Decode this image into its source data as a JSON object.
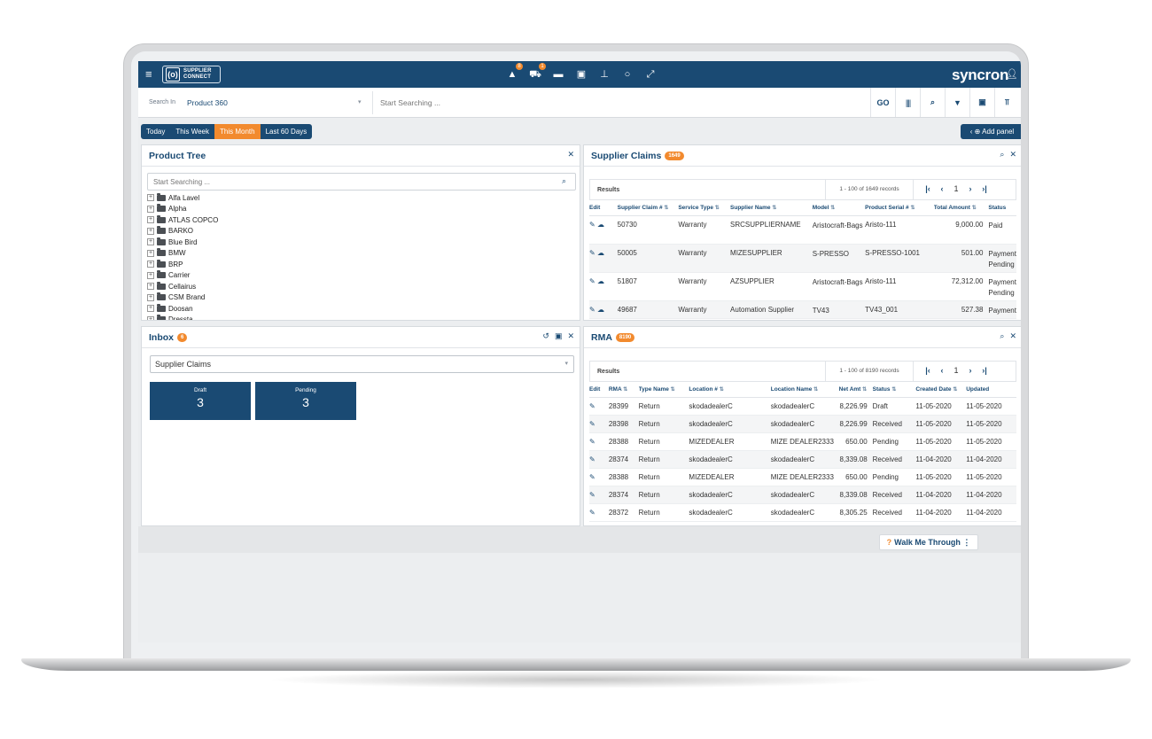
{
  "topbar": {
    "logo_mark": "(o)",
    "logo_line1": "SUPPLIER",
    "logo_line2": "CONNECT",
    "brand": "syncron",
    "icons": [
      {
        "name": "bell-icon",
        "glyph": "▲",
        "badge": "8"
      },
      {
        "name": "cart-icon",
        "glyph": "⛟",
        "badge": "1"
      },
      {
        "name": "monitor-icon",
        "glyph": "▬",
        "badge": ""
      },
      {
        "name": "box-icon",
        "glyph": "▣",
        "badge": ""
      },
      {
        "name": "download-icon",
        "glyph": "⊥",
        "badge": ""
      },
      {
        "name": "clock-icon",
        "glyph": "○",
        "badge": ""
      },
      {
        "name": "expand-icon",
        "glyph": "⤢",
        "badge": ""
      }
    ]
  },
  "search": {
    "in_label": "Search In",
    "in_value": "Product 360",
    "placeholder": "Start Searching ...",
    "go_label": "GO"
  },
  "date_range": {
    "options": [
      "Today",
      "This Week",
      "This Month",
      "Last 60 Days"
    ],
    "active": "This Month"
  },
  "add_panel_label": "Add panel",
  "product_tree": {
    "title": "Product Tree",
    "search_placeholder": "Start Searching ...",
    "items": [
      "Alfa Lavel",
      "Alpha",
      "ATLAS COPCO",
      "BARKO",
      "Blue Bird",
      "BMW",
      "BRP",
      "Carrier",
      "Cellairus",
      "CSM Brand",
      "Doosan",
      "Dressta"
    ]
  },
  "supplier_claims": {
    "title": "Supplier Claims",
    "count": "1649",
    "results_label": "Results",
    "records": "1 - 100 of 1649 records",
    "page": "1",
    "columns": [
      "Edit",
      "Supplier Claim #",
      "Service Type",
      "Supplier Name",
      "Model",
      "Product Serial #",
      "Total Amount",
      "Status"
    ],
    "rows": [
      {
        "claim": "50730",
        "service": "Warranty",
        "supplier": "SRCSUPPLIERNAME",
        "model": "Aristocraft-Bags",
        "serial": "Aristo-111",
        "amount": "9,000.00",
        "status": "Paid"
      },
      {
        "claim": "50005",
        "service": "Warranty",
        "supplier": "MIZESUPPLIER",
        "model": "S-PRESSO",
        "serial": "S-PRESSO-1001",
        "amount": "501.00",
        "status": "Payment Pending"
      },
      {
        "claim": "51807",
        "service": "Warranty",
        "supplier": "AZSUPPLIER",
        "model": "Aristocraft-Bags",
        "serial": "Aristo-111",
        "amount": "72,312.00",
        "status": "Payment Pending"
      },
      {
        "claim": "49687",
        "service": "Warranty",
        "supplier": "Automation Supplier",
        "model": "TV43",
        "serial": "TV43_001",
        "amount": "527.38",
        "status": "Payment"
      }
    ]
  },
  "inbox": {
    "title": "Inbox",
    "count": "6",
    "selected": "Supplier Claims",
    "tiles": [
      {
        "label": "Draft",
        "value": "3"
      },
      {
        "label": "Pending",
        "value": "3"
      }
    ]
  },
  "rma": {
    "title": "RMA",
    "count": "8190",
    "results_label": "Results",
    "records": "1 - 100 of 8190 records",
    "page": "1",
    "columns": [
      "Edit",
      "RMA",
      "Type Name",
      "Location #",
      "Location Name",
      "Net Amt",
      "Status",
      "Created Date",
      "Updated"
    ],
    "rows": [
      {
        "rma": "28399",
        "type": "Return",
        "loc": "skodadealerC",
        "locname": "skodadealerC",
        "net": "8,226.99",
        "status": "Draft",
        "created": "11-05-2020",
        "updated": "11-05-2020"
      },
      {
        "rma": "28398",
        "type": "Return",
        "loc": "skodadealerC",
        "locname": "skodadealerC",
        "net": "8,226.99",
        "status": "Received",
        "created": "11-05-2020",
        "updated": "11-05-2020"
      },
      {
        "rma": "28388",
        "type": "Return",
        "loc": "MIZEDEALER",
        "locname": "MIZE DEALER2333",
        "net": "650.00",
        "status": "Pending",
        "created": "11-05-2020",
        "updated": "11-05-2020"
      },
      {
        "rma": "28374",
        "type": "Return",
        "loc": "skodadealerC",
        "locname": "skodadealerC",
        "net": "8,339.08",
        "status": "Received",
        "created": "11-04-2020",
        "updated": "11-04-2020"
      },
      {
        "rma": "28388",
        "type": "Return",
        "loc": "MIZEDEALER",
        "locname": "MIZE DEALER2333",
        "net": "650.00",
        "status": "Pending",
        "created": "11-05-2020",
        "updated": "11-05-2020"
      },
      {
        "rma": "28374",
        "type": "Return",
        "loc": "skodadealerC",
        "locname": "skodadealerC",
        "net": "8,339.08",
        "status": "Received",
        "created": "11-04-2020",
        "updated": "11-04-2020"
      },
      {
        "rma": "28372",
        "type": "Return",
        "loc": "skodadealerC",
        "locname": "skodadealerC",
        "net": "8,305.25",
        "status": "Received",
        "created": "11-04-2020",
        "updated": "11-04-2020"
      }
    ]
  },
  "walkme_label": "Walk Me Through",
  "colors": {
    "primary": "#1a4a73",
    "accent": "#f28a2e"
  }
}
